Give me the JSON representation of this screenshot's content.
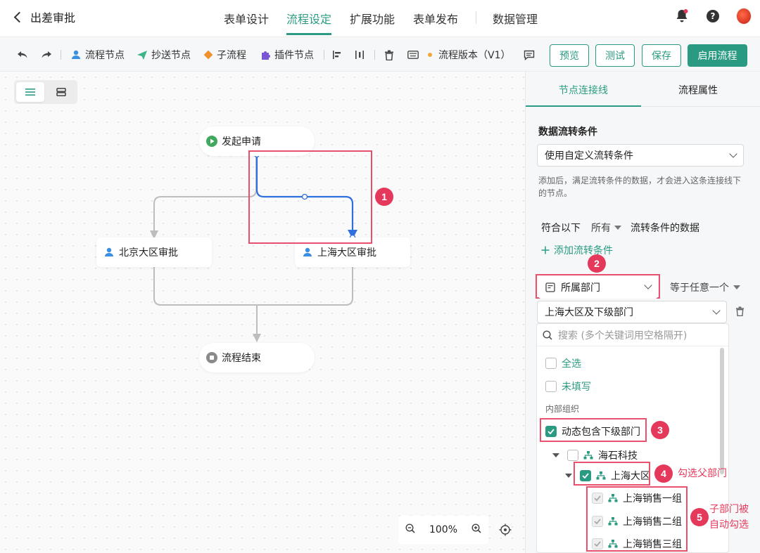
{
  "header": {
    "back_title": "出差审批",
    "tabs": [
      {
        "label": "表单设计"
      },
      {
        "label": "流程设定"
      },
      {
        "label": "扩展功能"
      },
      {
        "label": "表单发布"
      },
      {
        "label": "数据管理"
      }
    ]
  },
  "toolbar": {
    "flow_node": "流程节点",
    "cc_node": "抄送节点",
    "sub_flow": "子流程",
    "plugin_node": "插件节点",
    "version": "流程版本（V1）",
    "preview": "预览",
    "test": "测试",
    "save": "保存",
    "enable": "启用流程"
  },
  "canvas": {
    "start_node": "发起申请",
    "beijing_node": "北京大区审批",
    "shanghai_node": "上海大区审批",
    "end_node": "流程结束",
    "zoom": "100%"
  },
  "panel": {
    "tab_connection": "节点连接线",
    "tab_properties": "流程属性",
    "condition_title": "数据流转条件",
    "condition_select": "使用自定义流转条件",
    "hint": "添加后，满足流转条件的数据，才会进入这条连接线下的节点。",
    "match_prefix": "符合以下",
    "match_scope": "所有",
    "match_suffix": "流转条件的数据",
    "add_condition": "添加流转条件",
    "field_select": "所属部门",
    "operator": "等于任意一个",
    "value_select": "上海大区及下级部门",
    "search_placeholder": "搜索 (多个关键词用空格隔开)",
    "select_all": "全选",
    "not_filled": "未填写",
    "section_label": "内部组织",
    "dynamic_include": "动态包含下级部门",
    "tree": {
      "root": "海石科技",
      "region": "上海大区",
      "children": [
        "上海销售一组",
        "上海销售二组",
        "上海销售三组"
      ]
    }
  },
  "annotations": {
    "badges": [
      "1",
      "2",
      "3",
      "4",
      "5"
    ],
    "note4": "勾选父部门",
    "note5_line1": "子部门被",
    "note5_line2": "自动勾选"
  },
  "colors": {
    "accent": "#2a9b82",
    "callout": "#e5395c",
    "connector_selected": "#2f6fde"
  }
}
